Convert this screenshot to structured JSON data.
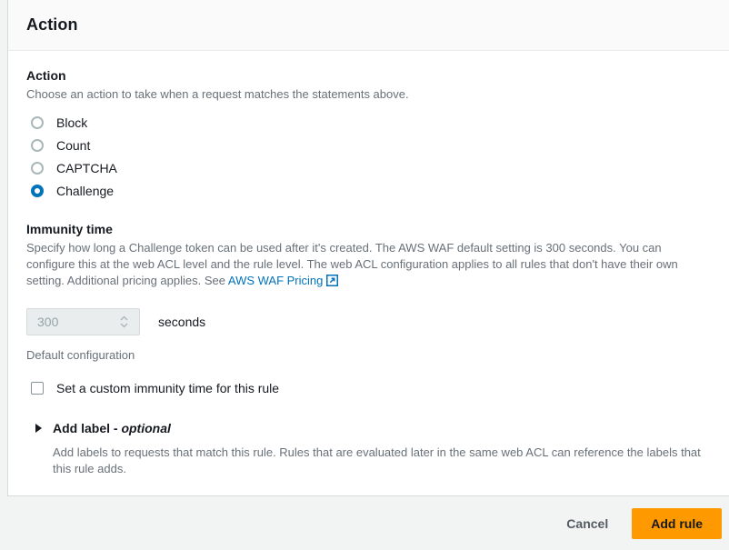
{
  "header": {
    "title": "Action"
  },
  "action_section": {
    "label": "Action",
    "description": "Choose an action to take when a request matches the statements above.",
    "options": [
      {
        "label": "Block",
        "selected": false
      },
      {
        "label": "Count",
        "selected": false
      },
      {
        "label": "CAPTCHA",
        "selected": false
      },
      {
        "label": "Challenge",
        "selected": true
      }
    ]
  },
  "immunity_section": {
    "label": "Immunity time",
    "description_before_link": "Specify how long a Challenge token can be used after it's created. The AWS WAF default setting is 300 seconds. You can configure this at the web ACL level and the rule level. The web ACL configuration applies to all rules that don't have their own setting. Additional pricing applies. See ",
    "link_text": "AWS WAF Pricing",
    "link_icon": "external-link-icon",
    "input_value": "300",
    "input_placeholder": "300",
    "unit_label": "seconds",
    "helper_text": "Default configuration",
    "checkbox_label": "Set a custom immunity time for this rule",
    "checkbox_checked": false
  },
  "add_label_section": {
    "expanded": false,
    "caret_icon": "caret-right-icon",
    "title": "Add label - ",
    "title_optional": "optional",
    "description": "Add labels to requests that match this rule. Rules that are evaluated later in the same web ACL can reference the labels that this rule adds."
  },
  "footer": {
    "cancel_label": "Cancel",
    "submit_label": "Add rule"
  },
  "colors": {
    "accent_blue": "#0073bb",
    "primary_orange": "#ff9900",
    "text_primary": "#16191f",
    "text_secondary": "#687078"
  }
}
